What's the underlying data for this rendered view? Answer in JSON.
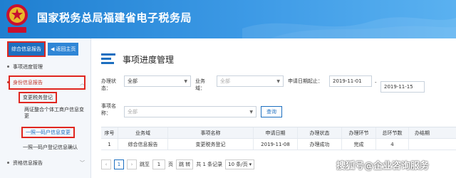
{
  "header": {
    "title": "国家税务总局福建省电子税务局",
    "emblem_text": "中国税务"
  },
  "sidebar": {
    "combined_label": "综合信息报告",
    "back_label": "返回主页",
    "items": [
      {
        "label": "事项进度管理"
      },
      {
        "label": "身份信息报告"
      }
    ],
    "sub_items": [
      {
        "label": "变更税务登记"
      },
      {
        "label": "两证整合个体工商户信息变更"
      },
      {
        "label": "一照一码户信息变更"
      },
      {
        "label": "一照一码户登记信息确认"
      }
    ],
    "bottom_item": "资格信息报告",
    "cut_item": "一一一一一一"
  },
  "main": {
    "title": "事项进度管理",
    "filters": {
      "status_label": "办理状态：",
      "status_value": "全部",
      "domain_label": "业务域：",
      "domain_value": "全部",
      "date_label": "申请日期起止：",
      "date_from": "2019-11-01",
      "date_sep": "-",
      "date_to": "2019-11-15",
      "item_label": "事项名称：",
      "item_value": "全部",
      "search_button": "查询"
    },
    "table": {
      "headers": [
        "序号",
        "业务域",
        "事项名称",
        "申请日期",
        "办理状态",
        "办理环节",
        "总环节数",
        "办结期"
      ],
      "rows": [
        [
          "1",
          "综合信息报告",
          "变更税务登记",
          "2019-11-08",
          "办理成功",
          "完成",
          "4",
          ""
        ]
      ]
    },
    "pager": {
      "first": "1",
      "jump_label": "跳至",
      "jump_value": "1",
      "page_unit": "页",
      "go_label": "跳 转",
      "total": "共 1 条记录",
      "size": "10 条/页"
    }
  },
  "watermark": "搜狐号@企业咨询服务"
}
